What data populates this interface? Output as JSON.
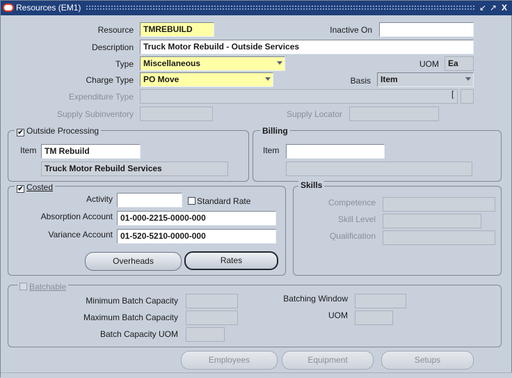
{
  "window": {
    "title": "Resources (EM1)",
    "controls": [
      "↙",
      "↗",
      "X"
    ]
  },
  "header": {
    "resource_label": "Resource",
    "resource_value": "TMREBUILD",
    "inactive_on_label": "Inactive On",
    "inactive_on_value": "",
    "description_label": "Description",
    "description_value": "Truck Motor Rebuild - Outside Services",
    "type_label": "Type",
    "type_value": "Miscellaneous",
    "uom_label": "UOM",
    "uom_value": "Ea",
    "charge_type_label": "Charge Type",
    "charge_type_value": "PO Move",
    "basis_label": "Basis",
    "basis_value": "Item",
    "expenditure_type_label": "Expenditure Type",
    "expenditure_type_value": "",
    "bracket": "[",
    "supply_subinventory_label": "Supply Subinventory",
    "supply_subinventory_value": "",
    "supply_locator_label": "Supply Locator",
    "supply_locator_value": ""
  },
  "outside_processing": {
    "title": "Outside Processing",
    "checked": true,
    "check_mark": "✔",
    "item_label": "Item",
    "item_value": "TM Rebuild",
    "item_description": "Truck Motor Rebuild Services"
  },
  "billing": {
    "title": "Billing",
    "item_label": "Item",
    "item_value": "",
    "item_description": ""
  },
  "costed": {
    "title": "Costed",
    "checked": true,
    "check_mark": "✔",
    "activity_label": "Activity",
    "activity_value": "",
    "standard_rate_label": "Standard Rate",
    "standard_rate_checked": false,
    "absorption_label": "Absorption Account",
    "absorption_value": "01-000-2215-0000-000",
    "variance_label": "Variance Account",
    "variance_value": "01-520-5210-0000-000",
    "overheads_label": "Overheads",
    "rates_label": "Rates"
  },
  "skills": {
    "title": "Skills",
    "competence_label": "Competence",
    "competence_value": "",
    "skill_level_label": "Skill Level",
    "skill_level_value": "",
    "qualification_label": "Qualification",
    "qualification_value": ""
  },
  "batch": {
    "title": "Batchable",
    "checked": false,
    "min_label": "Minimum Batch Capacity",
    "max_label": "Maximum Batch Capacity",
    "uom_capacity_label": "Batch Capacity UOM",
    "window_label": "Batching Window",
    "uom_label": "UOM"
  },
  "footer": {
    "employees_label": "Employees",
    "equipment_label": "Equipment",
    "setups_label": "Setups"
  },
  "colors": {
    "titlebar": "#1f3f7a",
    "background": "#c8d0dc",
    "required_field": "#ffffa8",
    "logo": "#e23a2a"
  }
}
